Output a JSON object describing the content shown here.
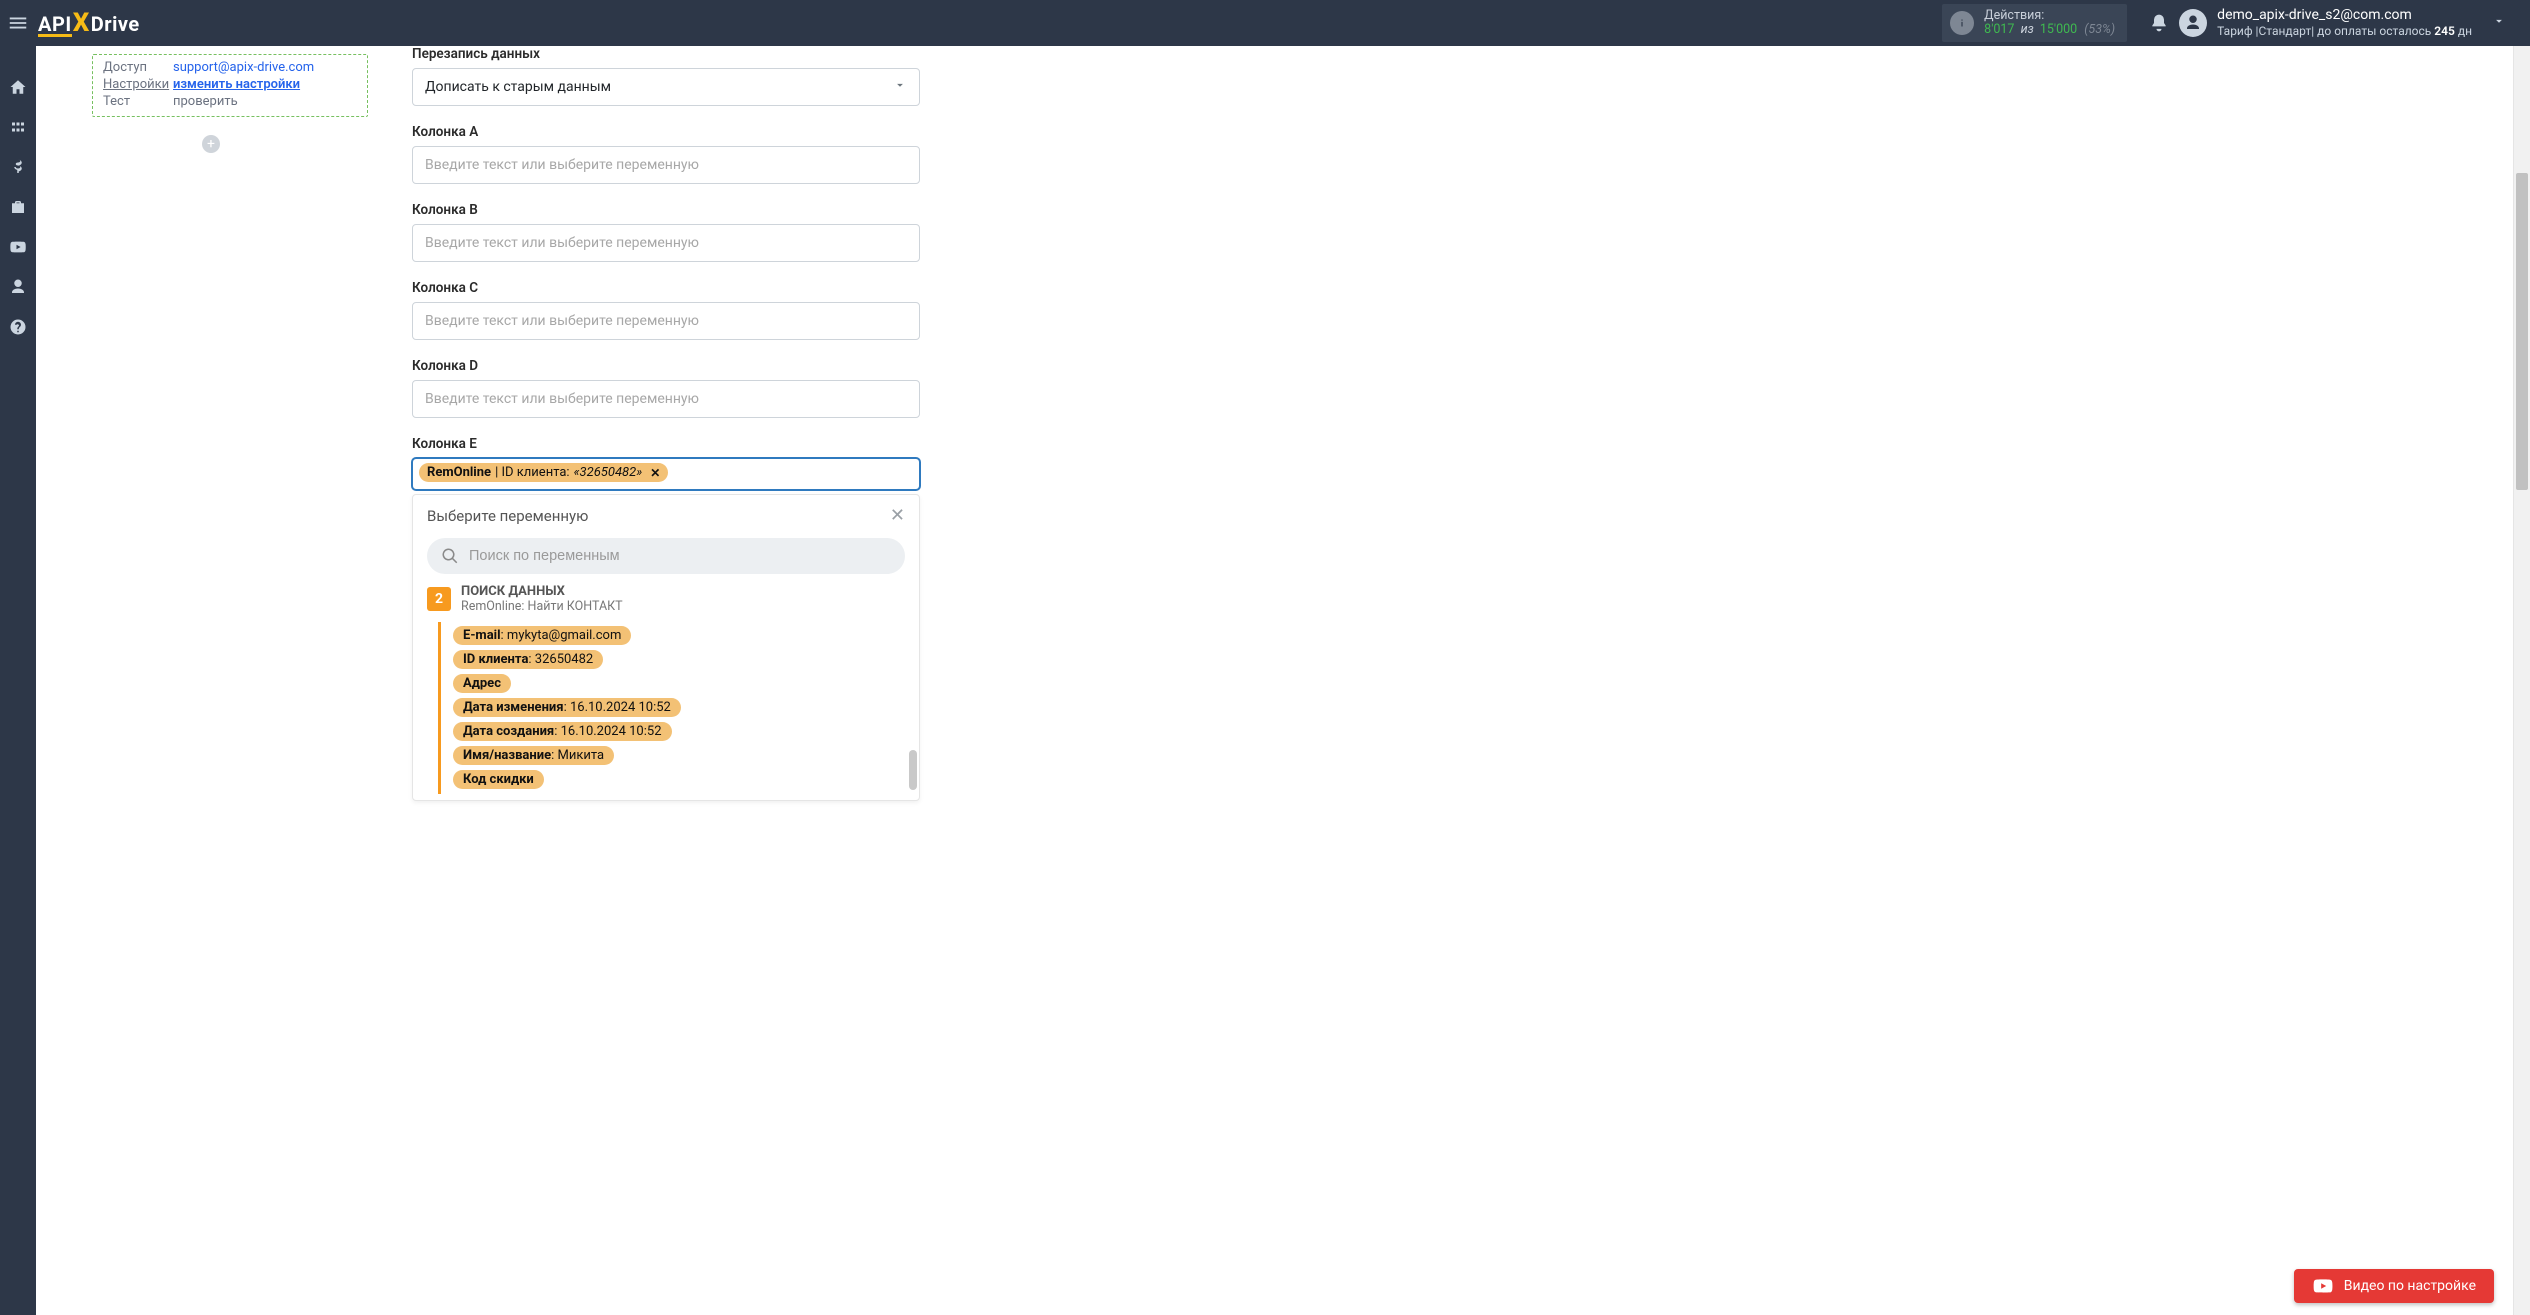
{
  "brand": {
    "api": "API",
    "x": "X",
    "drive": "Drive"
  },
  "header": {
    "actions_label": "Действия:",
    "usage": "8'017",
    "of": "из",
    "limit": "15'000",
    "pct": "(53%)",
    "user_email": "demo_apix-drive_s2@com.com",
    "tariff_prefix": "Тариф |Стандарт| до оплаты осталось ",
    "days": "245",
    "days_suffix": " дн"
  },
  "step": {
    "access_key": "Доступ",
    "access_val": "support@apix-drive.com",
    "settings_key": "Настройки",
    "settings_val": "изменить настройки",
    "test_key": "Тест",
    "test_val": "проверить"
  },
  "fields": {
    "overwrite_label": "Перезапись данных",
    "overwrite_value": "Дописать к старым данным",
    "placeholder": "Введите текст или выберите переменную",
    "colA": "Колонка A",
    "colB": "Колонка B",
    "colC": "Колонка C",
    "colD": "Колонка D",
    "colE": "Колонка E"
  },
  "colE_tag": {
    "source": "RemOnline",
    "label_sep": " | ID клиента: ",
    "value": "«32650482»"
  },
  "dropdown": {
    "title": "Выберите переменную",
    "search_placeholder": "Поиск по переменным",
    "source_badge": "2",
    "source_title": "ПОИСК ДАННЫХ",
    "source_sub": "RemOnline: Найти КОНТАКТ",
    "vars": [
      {
        "k": "E-mail",
        "v": ": mykyta@gmail.com"
      },
      {
        "k": "ID клиента",
        "v": ": 32650482"
      },
      {
        "k": "Адрес",
        "v": ""
      },
      {
        "k": "Дата изменения",
        "v": ": 16.10.2024 10:52"
      },
      {
        "k": "Дата создания",
        "v": ": 16.10.2024 10:52"
      },
      {
        "k": "Имя/название",
        "v": ": Микита"
      },
      {
        "k": "Код скидки",
        "v": ""
      }
    ]
  },
  "video_btn": "Видео по настройке"
}
